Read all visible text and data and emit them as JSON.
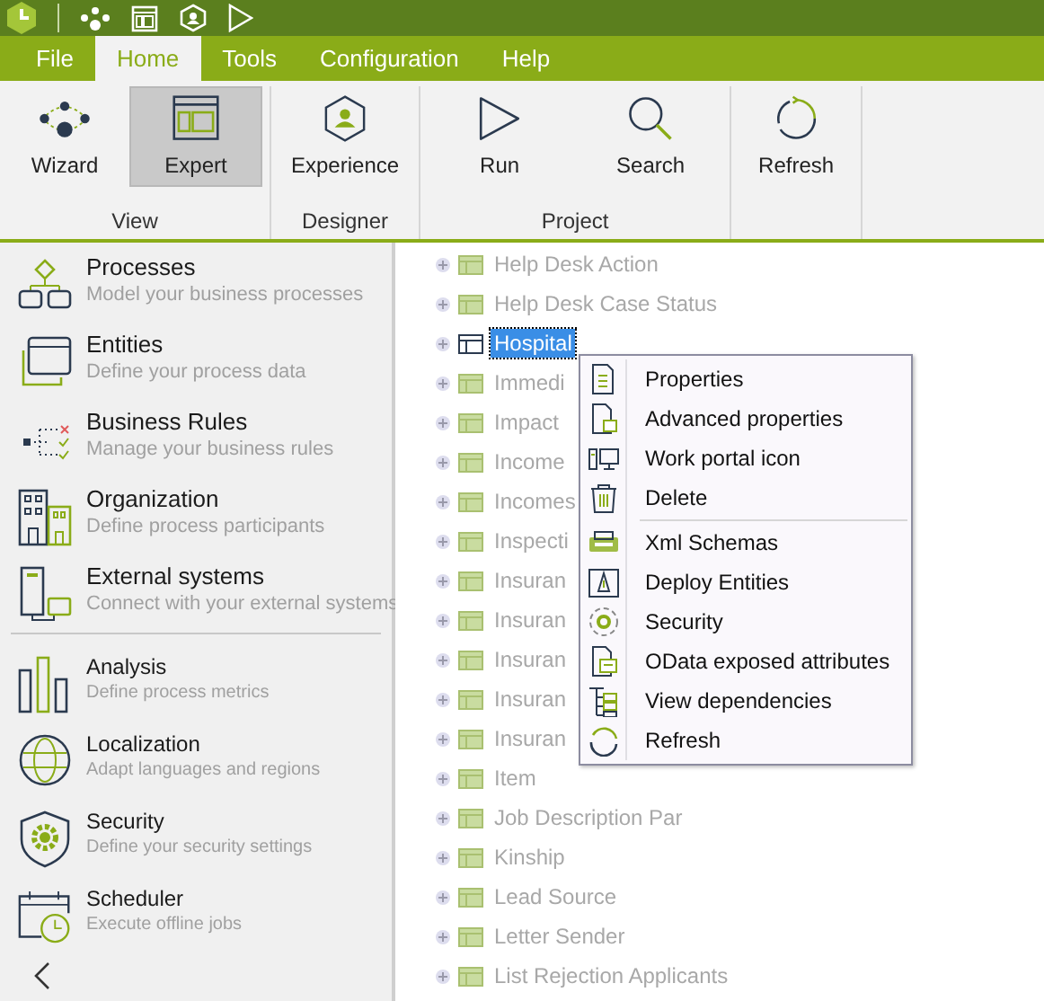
{
  "menu_tabs": [
    {
      "label": "File",
      "selected": false
    },
    {
      "label": "Home",
      "selected": true
    },
    {
      "label": "Tools",
      "selected": false
    },
    {
      "label": "Configuration",
      "selected": false
    },
    {
      "label": "Help",
      "selected": false
    }
  ],
  "ribbon": {
    "groups": [
      {
        "label": "View",
        "buttons": [
          {
            "label": "Wizard",
            "kind": "wizard",
            "selected": false
          },
          {
            "label": "Expert",
            "kind": "expert",
            "selected": true
          }
        ]
      },
      {
        "label": "Designer",
        "buttons": [
          {
            "label": "Experience",
            "kind": "experience",
            "selected": false
          }
        ]
      },
      {
        "label": "Project",
        "buttons": [
          {
            "label": "Run",
            "kind": "run",
            "selected": false
          },
          {
            "label": "Search",
            "kind": "search",
            "selected": false
          }
        ]
      },
      {
        "buttons": [
          {
            "label": "Refresh",
            "kind": "refresh",
            "selected": false
          }
        ]
      }
    ]
  },
  "sidebar": {
    "sections": [
      [
        {
          "title": "Processes",
          "subtitle": "Model your business processes",
          "kind": "processes"
        },
        {
          "title": "Entities",
          "subtitle": "Define your process data",
          "kind": "entities"
        },
        {
          "title": "Business Rules",
          "subtitle": "Manage your business rules",
          "kind": "rules"
        },
        {
          "title": "Organization",
          "subtitle": "Define process participants",
          "kind": "organization"
        },
        {
          "title": "External systems",
          "subtitle": "Connect with your external systems",
          "kind": "external"
        }
      ],
      [
        {
          "title": "Analysis",
          "subtitle": "Define process metrics",
          "kind": "analysis"
        },
        {
          "title": "Localization",
          "subtitle": "Adapt languages and regions",
          "kind": "localization"
        },
        {
          "title": "Security",
          "subtitle": "Define your security settings",
          "kind": "security"
        },
        {
          "title": "Scheduler",
          "subtitle": "Execute offline jobs",
          "kind": "scheduler"
        }
      ]
    ]
  },
  "tree": {
    "items": [
      {
        "label": "Help Desk Action",
        "selected": false
      },
      {
        "label": "Help Desk Case Status",
        "selected": false
      },
      {
        "label": "Hospital",
        "selected": true
      },
      {
        "label": "Immedi",
        "selected": false
      },
      {
        "label": "Impact",
        "selected": false
      },
      {
        "label": "Income",
        "selected": false
      },
      {
        "label": "Incomes",
        "selected": false
      },
      {
        "label": "Inspecti",
        "selected": false
      },
      {
        "label": "Insuran",
        "selected": false
      },
      {
        "label": "Insuran",
        "selected": false
      },
      {
        "label": "Insuran",
        "selected": false
      },
      {
        "label": "Insuran",
        "selected": false
      },
      {
        "label": "Insuran",
        "selected": false
      },
      {
        "label": "Item",
        "selected": false
      },
      {
        "label": "Job Description Par",
        "selected": false
      },
      {
        "label": "Kinship",
        "selected": false
      },
      {
        "label": "Lead Source",
        "selected": false
      },
      {
        "label": "Letter Sender",
        "selected": false
      },
      {
        "label": "List Rejection Applicants",
        "selected": false
      }
    ]
  },
  "context_menu": {
    "groups": [
      [
        {
          "label": "Properties",
          "kind": "properties"
        },
        {
          "label": "Advanced properties",
          "kind": "advanced"
        },
        {
          "label": "Work portal icon",
          "kind": "portal"
        },
        {
          "label": "Delete",
          "kind": "delete"
        }
      ],
      [
        {
          "label": "Xml Schemas",
          "kind": "xml"
        },
        {
          "label": "Deploy Entities",
          "kind": "deploy"
        },
        {
          "label": "Security",
          "kind": "security"
        },
        {
          "label": "OData exposed attributes",
          "kind": "odata"
        },
        {
          "label": "View dependencies",
          "kind": "dependencies"
        },
        {
          "label": "Refresh",
          "kind": "refresh"
        }
      ]
    ]
  }
}
